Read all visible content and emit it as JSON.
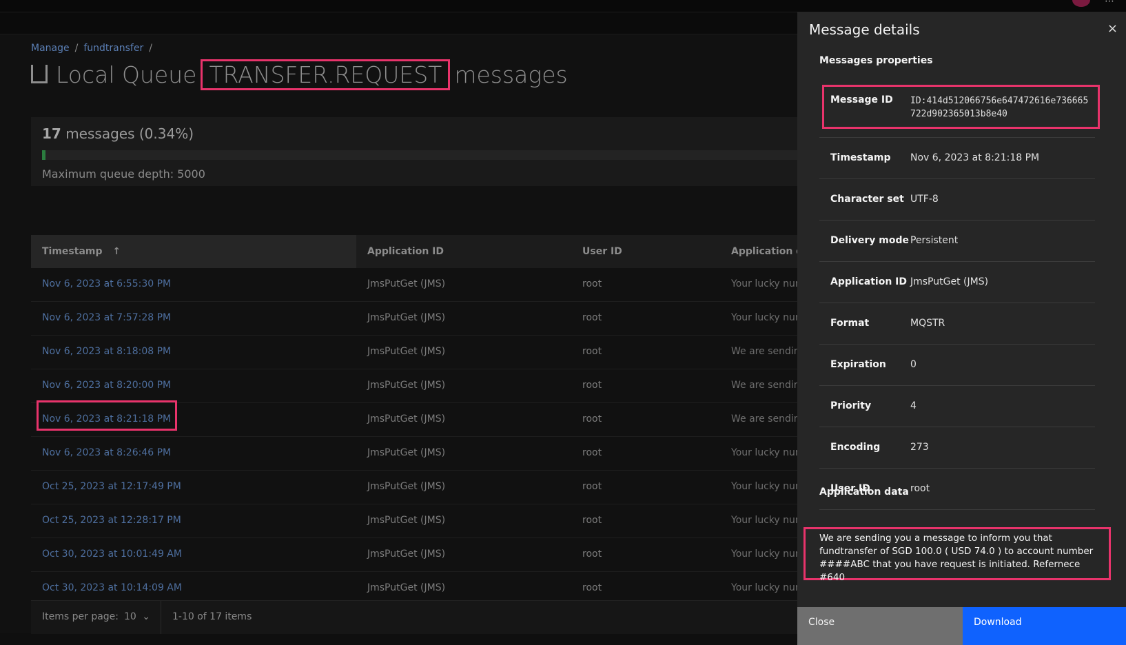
{
  "breadcrumb": [
    "Manage",
    "fundtransfer"
  ],
  "page": {
    "title_prefix": "Local Queue",
    "queue_name": "TRANSFER.REQUEST",
    "title_suffix": "messages"
  },
  "queue_tile": {
    "count": "17",
    "count_label": "messages (0.34%)",
    "depth_fraction": 0.0034,
    "max_depth": "Maximum queue depth: 5000"
  },
  "table": {
    "columns": [
      "Timestamp",
      "Application ID",
      "User ID",
      "Application data"
    ],
    "rows": [
      {
        "timestamp": "Nov 6, 2023 at 6:55:30 PM",
        "app_id": "JmsPutGet (JMS)",
        "user_id": "root",
        "data": "Your lucky num"
      },
      {
        "timestamp": "Nov 6, 2023 at 7:57:28 PM",
        "app_id": "JmsPutGet (JMS)",
        "user_id": "root",
        "data": "Your lucky num"
      },
      {
        "timestamp": "Nov 6, 2023 at 8:18:08 PM",
        "app_id": "JmsPutGet (JMS)",
        "user_id": "root",
        "data": "We are sending"
      },
      {
        "timestamp": "Nov 6, 2023 at 8:20:00 PM",
        "app_id": "JmsPutGet (JMS)",
        "user_id": "root",
        "data": "We are sending"
      },
      {
        "timestamp": "Nov 6, 2023 at 8:21:18 PM",
        "app_id": "JmsPutGet (JMS)",
        "user_id": "root",
        "data": "We are sending"
      },
      {
        "timestamp": "Nov 6, 2023 at 8:26:46 PM",
        "app_id": "JmsPutGet (JMS)",
        "user_id": "root",
        "data": "Your lucky num"
      },
      {
        "timestamp": "Oct 25, 2023 at 12:17:49 PM",
        "app_id": "JmsPutGet (JMS)",
        "user_id": "root",
        "data": "Your lucky num"
      },
      {
        "timestamp": "Oct 25, 2023 at 12:28:17 PM",
        "app_id": "JmsPutGet (JMS)",
        "user_id": "root",
        "data": "Your lucky num"
      },
      {
        "timestamp": "Oct 30, 2023 at 10:01:49 AM",
        "app_id": "JmsPutGet (JMS)",
        "user_id": "root",
        "data": "Your lucky num"
      },
      {
        "timestamp": "Oct 30, 2023 at 10:14:09 AM",
        "app_id": "JmsPutGet (JMS)",
        "user_id": "root",
        "data": "Your lucky num"
      }
    ]
  },
  "pagination": {
    "items_per_page_label": "Items per page:",
    "items_per_page": "10",
    "range": "1-10 of 17 items"
  },
  "panel": {
    "title": "Message details",
    "close_icon": "×",
    "properties_heading": "Messages properties",
    "properties": [
      {
        "key": "Message ID",
        "value": "ID:414d512066756e647472616e736665722d902365013b8e40"
      },
      {
        "key": "Timestamp",
        "value": "Nov 6, 2023 at 8:21:18 PM"
      },
      {
        "key": "Character set",
        "value": "UTF-8"
      },
      {
        "key": "Delivery mode",
        "value": "Persistent"
      },
      {
        "key": "Application ID",
        "value": "JmsPutGet (JMS)"
      },
      {
        "key": "Format",
        "value": "MQSTR"
      },
      {
        "key": "Expiration",
        "value": "0"
      },
      {
        "key": "Priority",
        "value": "4"
      },
      {
        "key": "Encoding",
        "value": "273"
      },
      {
        "key": "User ID",
        "value": "root"
      }
    ],
    "app_data_heading": "Application data",
    "app_data": "We are sending you a message to inform you that fundtransfer of SGD 100.0 ( USD 74.0 ) to account number ####ABC that you have request is initiated. Refernece #640",
    "close_button": "Close",
    "download_button": "Download"
  },
  "colors": {
    "highlight": "#e8336b",
    "primary_button": "#0f62fe",
    "link": "#4e6f9f",
    "progress": "#2b7d3f"
  }
}
